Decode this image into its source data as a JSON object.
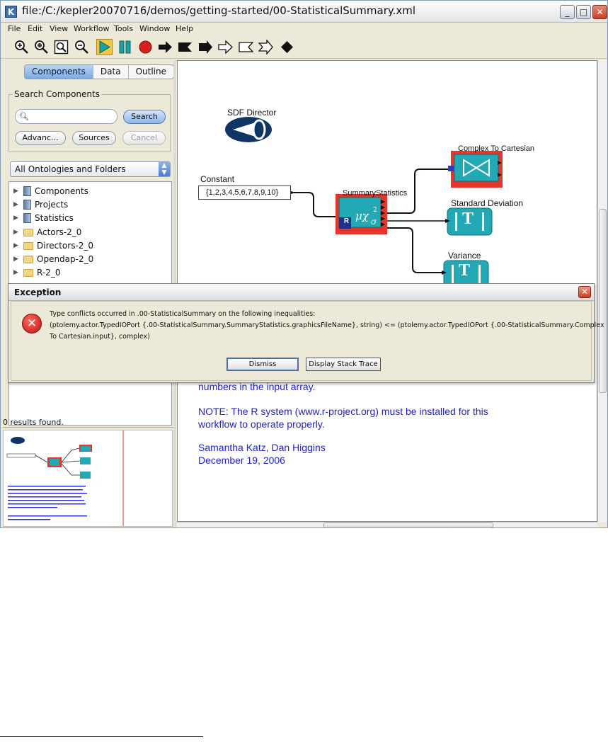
{
  "window": {
    "title": "file:/C:/kepler20070716/demos/getting-started/00-StatisticalSummary.xml",
    "app_icon_letter": "K",
    "controls": [
      "_",
      "□",
      "✕"
    ]
  },
  "menubar": [
    "File",
    "Edit",
    "View",
    "Workflow",
    "Tools",
    "Window",
    "Help"
  ],
  "toolbar": {
    "buttons": [
      "zoom-in",
      "zoom-reset",
      "zoom-fit",
      "zoom-out",
      "run",
      "pause",
      "stop",
      "port-output",
      "port-input",
      "port-io",
      "relation-output",
      "relation-input",
      "relation-io",
      "relation-diamond"
    ],
    "active": "run"
  },
  "sidebar": {
    "tabs": [
      "Components",
      "Data",
      "Outline"
    ],
    "active_tab": "Components",
    "search": {
      "legend": "Search Components",
      "query": "",
      "search_button": "Search",
      "advanced_button": "Advanc...",
      "sources_button": "Sources",
      "cancel_button": "Cancel"
    },
    "ontology_select": "All Ontologies and Folders",
    "tree": [
      {
        "label": "Components",
        "icon": "book"
      },
      {
        "label": "Projects",
        "icon": "book"
      },
      {
        "label": "Statistics",
        "icon": "book"
      },
      {
        "label": "Actors-2_0",
        "icon": "folder"
      },
      {
        "label": "Directors-2_0",
        "icon": "folder"
      },
      {
        "label": "Opendap-2_0",
        "icon": "folder"
      },
      {
        "label": "R-2_0",
        "icon": "folder"
      }
    ],
    "results": "0 results found."
  },
  "canvas": {
    "director_label": "SDF Director",
    "constant_label": "Constant",
    "constant_value": "{1,2,3,4,5,6,7,8,9,10}",
    "summary_label": "SummaryStatistics",
    "summary_badge": "R",
    "complex_label": "Complex To Cartesian",
    "stddev_label": "Standard Deviation",
    "variance_label": "Variance",
    "display_glyph": "T",
    "note_lines": [
      "numbers in the input array.",
      "NOTE: The R system (www.r-project.org) must be installed for this",
      "workflow to operate properly.",
      "Samantha Katz, Dan Higgins",
      "December 19, 2006"
    ]
  },
  "dialog": {
    "title": "Exception",
    "error_glyph": "✕",
    "message_lines": [
      "Type conflicts occurred in .00-StatisticalSummary on the following inequalities:",
      "  (ptolemy.actor.TypedIOPort {.00-StatisticalSummary.SummaryStatistics.graphicsFileName}, string) <= (ptolemy.actor.TypedIOPort {.00-StatisticalSummary.Complex",
      "To Cartesian.input}, complex)"
    ],
    "dismiss_button": "Dismiss",
    "stack_trace_button": "Display Stack Trace"
  },
  "colors": {
    "actor_red": "#e8352c",
    "actor_teal": "#22a9b5",
    "director_navy": "#0f3565",
    "note_blue": "#1f1fd6",
    "run_highlight": "#f5c542"
  }
}
